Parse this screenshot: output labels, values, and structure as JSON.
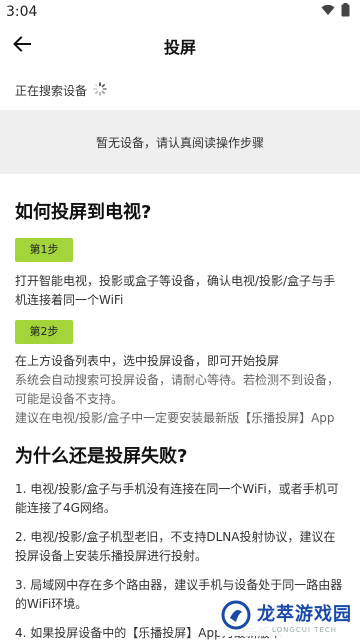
{
  "status_bar": {
    "time": "3:04"
  },
  "header": {
    "title": "投屏"
  },
  "search": {
    "status": "正在搜索设备"
  },
  "empty_state": {
    "message": "暂无设备，请认真阅读操作步骤"
  },
  "how_section": {
    "title": "如何投屏到电视?",
    "step1": {
      "badge": "第1步",
      "text": "打开智能电视，投影或盒子等设备，确认电视/投影/盒子与手机连接着同一个WiFi"
    },
    "step2": {
      "badge": "第2步",
      "line1": "在上方设备列表中，选中投屏设备，即可开始投屏",
      "line2": "系统会自动搜索可投屏设备，请耐心等待。若检测不到设备，可能是设备不支持。",
      "line3": "建议在电视/投影/盒子中一定要安装最新版【乐播投屏】App"
    }
  },
  "why_section": {
    "title": "为什么还是投屏失败?",
    "reasons": [
      "1. 电视/投影/盒子与手机没有连接在同一个WiFi，或者手机可能连接了4G网络。",
      "2. 电视/投影/盒子机型老旧，不支持DLNA投射协议，建议在投屏设备上安装乐播投屏进行投射。",
      "3. 局域网中存在多个路由器，建议手机与设备处于同一路由器的WiFi环境。",
      "4. 如果投屏设备中的【乐播投屏】App为最新版本"
    ]
  },
  "watermark": {
    "main": "龙萃游戏园",
    "sub": "LONGCUI TECH"
  },
  "colors": {
    "step_badge": "#a3d53a",
    "empty_bg": "#efefef",
    "watermark_blue": "#1a4aa8"
  }
}
